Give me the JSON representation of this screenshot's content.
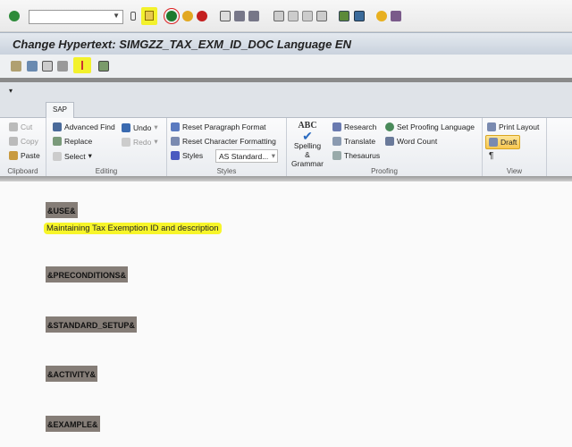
{
  "system_toolbar": {
    "command_field": "",
    "icons": [
      "enter-icon",
      "save-icon",
      "back-icon",
      "exit-icon",
      "cancel-icon",
      "print-icon",
      "find-icon",
      "find-next-icon",
      "first-page-icon",
      "prev-page-icon",
      "next-page-icon",
      "last-page-icon",
      "new-session-icon",
      "shortcut-icon",
      "help-icon",
      "layout-icon"
    ]
  },
  "title": "Change Hypertext: SIMGZZ_TAX_EXM_ID_DOC Language EN",
  "ribbon": {
    "tab": "SAP",
    "clipboard": {
      "label": "Clipboard",
      "cut": "Cut",
      "copy": "Copy",
      "paste": "Paste"
    },
    "editing": {
      "label": "Editing",
      "advanced_find": "Advanced Find",
      "replace": "Replace",
      "select": "Select",
      "undo": "Undo",
      "redo": "Redo"
    },
    "styles": {
      "label": "Styles",
      "reset_paragraph": "Reset Paragraph Format",
      "reset_character": "Reset Character Formatting",
      "styles": "Styles",
      "style_value": "AS Standard..."
    },
    "proofing": {
      "label": "Proofing",
      "spelling_abc": "ABC",
      "spelling": "Spelling &",
      "grammar": "Grammar",
      "research": "Research",
      "translate": "Translate",
      "thesaurus": "Thesaurus",
      "set_language": "Set Proofing Language",
      "word_count": "Word Count"
    },
    "view": {
      "label": "View",
      "print_layout": "Print Layout",
      "draft": "Draft",
      "pilcrow": "¶"
    }
  },
  "document": {
    "sections": [
      "&USE&",
      "&PRECONDITIONS&",
      "&STANDARD_SETUP&",
      "&ACTIVITY&",
      "&EXAMPLE&"
    ],
    "use_text": "Maintaining Tax Exemption ID and description"
  },
  "colors": {
    "tag_bg": "#857d77",
    "highlight": "#f7f52a"
  }
}
